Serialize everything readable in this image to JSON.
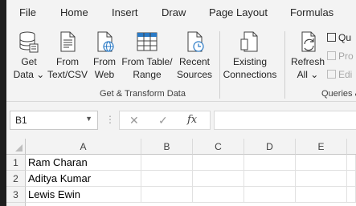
{
  "menu": {
    "tabs": [
      "File",
      "Home",
      "Insert",
      "Draw",
      "Page Layout",
      "Formulas"
    ]
  },
  "ribbon": {
    "get_data": {
      "line1": "Get",
      "line2": "Data ⌄"
    },
    "from_text_csv": {
      "line1": "From",
      "line2": "Text/CSV"
    },
    "from_web": {
      "line1": "From",
      "line2": "Web"
    },
    "from_table_range": {
      "line1": "From Table/",
      "line2": "Range"
    },
    "recent_sources": {
      "line1": "Recent",
      "line2": "Sources"
    },
    "existing_connections": {
      "line1": "Existing",
      "line2": "Connections"
    },
    "get_transform_label": "Get & Transform Data",
    "refresh_all": {
      "line1": "Refresh",
      "line2": "All ⌄"
    },
    "queries_small": [
      "Qu",
      "Pro",
      "Edi"
    ],
    "queries_label": "Queries &"
  },
  "formula_bar": {
    "name_box": "B1",
    "fx": "fx"
  },
  "sheet": {
    "columns": [
      "A",
      "B",
      "C",
      "D",
      "E"
    ],
    "rows": [
      {
        "num": "1",
        "A": "Ram Charan"
      },
      {
        "num": "2",
        "A": "Aditya Kumar"
      },
      {
        "num": "3",
        "A": "Lewis Ewin"
      }
    ]
  }
}
